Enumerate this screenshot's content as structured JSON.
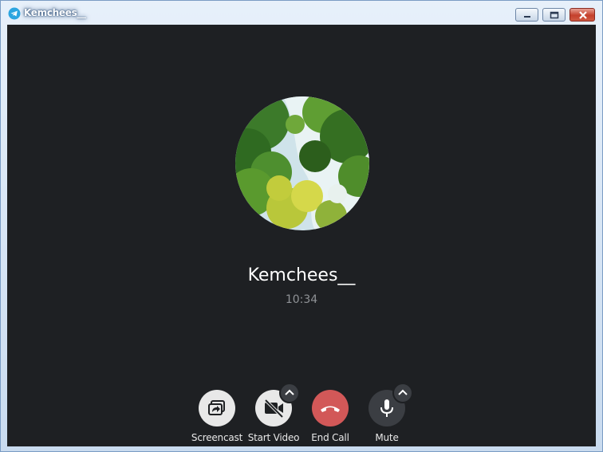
{
  "window": {
    "title": "Kemchees__"
  },
  "call": {
    "contact_name": "Kemchees__",
    "duration": "10:34"
  },
  "controls": [
    {
      "label": "Screencast"
    },
    {
      "label": "Start Video"
    },
    {
      "label": "End Call"
    },
    {
      "label": "Mute"
    }
  ],
  "icons": {
    "app": "telegram-icon",
    "screencast": "screencast-icon",
    "video": "video-off-icon",
    "end": "phone-hangup-icon",
    "mute": "microphone-icon",
    "settings": "chevron-up-icon"
  },
  "colors": {
    "background": "#1e2023",
    "end_call": "#d25858",
    "light_button": "#e8e8e8",
    "dark_button": "#3b3e43"
  }
}
